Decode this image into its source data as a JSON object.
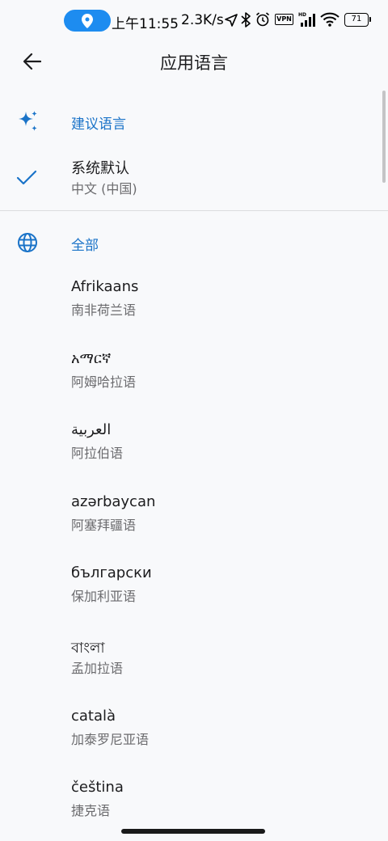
{
  "status_bar": {
    "time": "上午11:55",
    "net_speed": "2.3K/s",
    "vpn_label": "VPN",
    "battery": "71",
    "icons": [
      "location-icon",
      "navigation-icon",
      "bluetooth-icon",
      "alarm-icon",
      "vpn-icon",
      "signal-icon",
      "wifi-icon",
      "battery-icon"
    ]
  },
  "header": {
    "title": "应用语言",
    "back_icon": "arrow-left-icon"
  },
  "suggested": {
    "label": "建议语言",
    "icon": "sparkle-icon",
    "items": [
      {
        "name": "系统默认",
        "sub": "中文 (中国)",
        "selected": true
      }
    ]
  },
  "all": {
    "label": "全部",
    "icon": "globe-icon",
    "items": [
      {
        "name": "Afrikaans",
        "sub": "南非荷兰语"
      },
      {
        "name": "አማርኛ",
        "sub": "阿姆哈拉语"
      },
      {
        "name": "العربية",
        "sub": "阿拉伯语"
      },
      {
        "name": "azərbaycan",
        "sub": "阿塞拜疆语"
      },
      {
        "name": "български",
        "sub": "保加利亚语"
      },
      {
        "name": "বাংলা",
        "sub": "孟加拉语"
      },
      {
        "name": "català",
        "sub": "加泰罗尼亚语"
      },
      {
        "name": "čeština",
        "sub": "捷克语"
      }
    ]
  },
  "colors": {
    "accent": "#1a73c8",
    "background": "#f8f9fb",
    "location_pill": "#1d8cf0"
  }
}
